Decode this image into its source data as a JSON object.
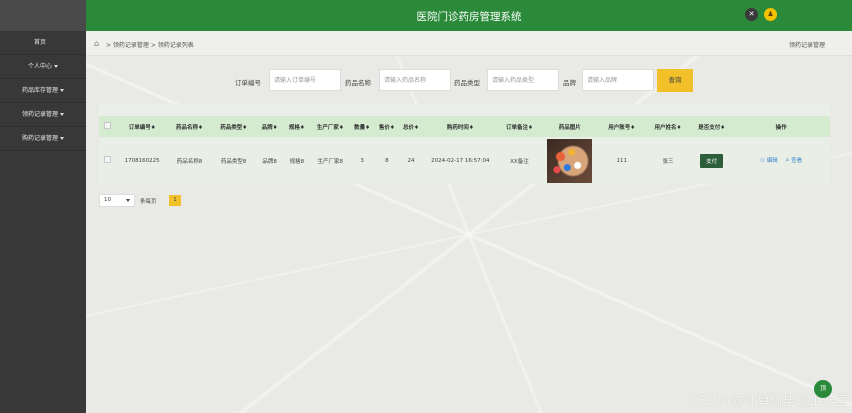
{
  "app": {
    "title": "医院门诊药房管理系统"
  },
  "sidebar": {
    "items": [
      {
        "label": "首页",
        "caret": false
      },
      {
        "label": "个人中心",
        "caret": true
      },
      {
        "label": "药品库存管理",
        "caret": true
      },
      {
        "label": "领药记录管理",
        "caret": true
      },
      {
        "label": "购药记录管理",
        "caret": true
      }
    ]
  },
  "breadcrumb": {
    "path": "> 领药记录管理 > 领药记录列表",
    "right": "领药记录管理"
  },
  "search": {
    "fields": [
      {
        "label": "订单编号",
        "placeholder": "请输入订单编号"
      },
      {
        "label": "药品名称",
        "placeholder": "请输入药品名称"
      },
      {
        "label": "药品类型",
        "placeholder": "请输入药品类型"
      },
      {
        "label": "品牌",
        "placeholder": "请输入品牌"
      }
    ],
    "button": "查询"
  },
  "table": {
    "headers": [
      "订单编号♦",
      "药品名称♦",
      "药品类型♦",
      "品牌♦",
      "规格♦",
      "生产厂家♦",
      "数量♦",
      "售价♦",
      "总价♦",
      "购药时间♦",
      "订单备注♦",
      "药品图片",
      "用户账号♦",
      "用户姓名♦",
      "是否支付♦",
      "操作"
    ],
    "rows": [
      {
        "order_no": "1708160225",
        "drug_name": "药品名称8",
        "drug_type": "药品类型8",
        "brand": "品牌8",
        "spec": "规格8",
        "maker": "生产厂家8",
        "qty": "3",
        "price": "8",
        "total": "24",
        "time": "2024-02-17 16:57:04",
        "note": "XX备注",
        "account": "111",
        "user_name": "张三",
        "pay": "支付",
        "op_edit": "编辑",
        "op_view": "查看"
      }
    ]
  },
  "pager": {
    "size": "10",
    "label": "条每页",
    "page": "1"
  },
  "watermark": "CSDN @计算机毕设工作室",
  "fab": "顶",
  "colors": {
    "header": "#2b8a3a",
    "sidebar": "#383838",
    "accent": "#f2c029"
  }
}
